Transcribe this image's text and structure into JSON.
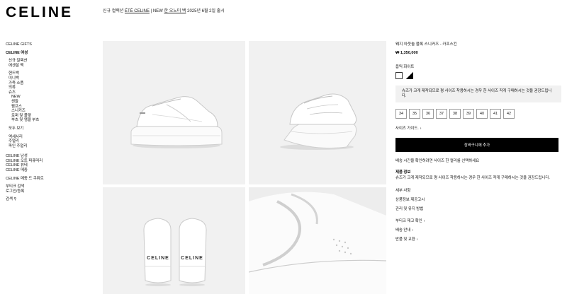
{
  "brand": {
    "logo": "CELINE"
  },
  "promo": {
    "pre": "신규 컬렉션 ",
    "link1": "ÉTÉ CELINE",
    "mid": " | NEW ",
    "link2": "한 오노미 백",
    "post": " 2025년 6월 2일 출시"
  },
  "sidebar": {
    "gifts": "CELINE GIFTS",
    "women": "CELINE 여성",
    "women_new": [
      "신규 컬렉션",
      "에센셜 백"
    ],
    "women_cats": [
      "핸드백",
      "미니백",
      "가죽 소품",
      "의류",
      "슈즈"
    ],
    "shoes_sub": [
      "NEW",
      "샌들",
      "펌프스",
      "스니커즈",
      "로퍼 및 플랫",
      "부츠 및 앵클 부츠"
    ],
    "view_all": "모두 보기",
    "women_more": [
      "액세서리",
      "주얼리",
      "파인 주얼리"
    ],
    "lines": [
      "CELINE 남성",
      "CELINE 오트 파퓨머리",
      "CELINE 뷰테",
      "CELINE 메종"
    ],
    "boutique": "CELINE 메종 드 쿠튀르",
    "account": [
      "부티크 검색",
      "로그인/등록"
    ],
    "search": "검색"
  },
  "product": {
    "name": "웨지 아웃솔 블록 스니커즈 - 카프스킨",
    "price": "₩ 1,350,000",
    "color": "옵틱 화이트",
    "note": "슈즈가 크게 제작되므로 평 사이즈 착용하시는 경우 한 사이즈 작게 구매하시는 것을 권장드립니다.",
    "sizes": [
      "34",
      "35",
      "36",
      "37",
      "38",
      "39",
      "40",
      "41",
      "42"
    ],
    "size_guide": "사이즈 가이드.",
    "add_to_cart": "장바구니에 추가",
    "delivery": "배송 시간을 확인하려면 사이즈 한 컬러를 선택하세요",
    "info_title": "제품 정보",
    "info_text": "슈즈가 크게 제작되므로 평 사이즈 착용하시는 경우 한 사이즈 작게 구매하시는 것을 권장드립니다.",
    "details": [
      "세부 사항",
      "상품정보 제공고시",
      "관리 및 유지 방법"
    ],
    "links": [
      "부티크 재고 확인",
      "배송 안내",
      "반품 및 교환"
    ]
  },
  "gallery": {
    "images": [
      "shoe-side-view",
      "shoe-three-quarter-view",
      "shoe-back-view",
      "shoe-detail-view"
    ],
    "heel_logo": "CELINE"
  },
  "colors": {
    "background": "#ffffff",
    "tile": "#f1f1f1",
    "button": "#000000",
    "note_bg": "#f1f1f1"
  }
}
